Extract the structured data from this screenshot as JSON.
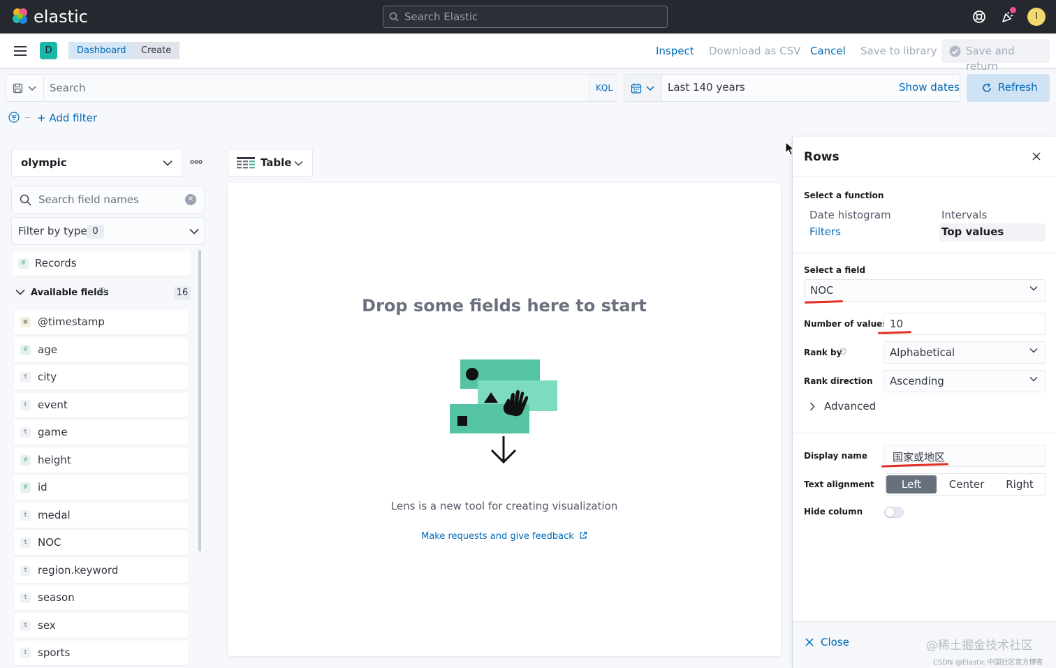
{
  "topbar": {
    "brand": "elastic",
    "search_placeholder": "Search Elastic",
    "avatar_initial": "I"
  },
  "header": {
    "space_initial": "D",
    "breadcrumbs": [
      "Dashboard",
      "Create"
    ],
    "actions": {
      "inspect": "Inspect",
      "download_csv": "Download as CSV",
      "cancel": "Cancel",
      "save_to_library": "Save to library",
      "save_and_return": "Save and return"
    }
  },
  "query": {
    "search_placeholder": "Search",
    "language": "KQL",
    "time_range": "Last 140 years",
    "show_dates": "Show dates",
    "refresh": "Refresh",
    "add_filter": "+ Add filter"
  },
  "datapanel": {
    "index_pattern": "olympic",
    "field_search_placeholder": "Search field names",
    "filter_by_type": "Filter by type",
    "filter_count": "0",
    "records_label": "Records",
    "available_label": "Available fields",
    "available_count": "16",
    "fields": [
      {
        "name": "@timestamp",
        "type": "date",
        "glyph": "▦"
      },
      {
        "name": "age",
        "type": "number",
        "glyph": "#"
      },
      {
        "name": "city",
        "type": "string",
        "glyph": "t"
      },
      {
        "name": "event",
        "type": "string",
        "glyph": "t"
      },
      {
        "name": "game",
        "type": "string",
        "glyph": "t"
      },
      {
        "name": "height",
        "type": "number",
        "glyph": "#"
      },
      {
        "name": "id",
        "type": "number",
        "glyph": "#"
      },
      {
        "name": "medal",
        "type": "string",
        "glyph": "t"
      },
      {
        "name": "NOC",
        "type": "string",
        "glyph": "t"
      },
      {
        "name": "region.keyword",
        "type": "string",
        "glyph": "t"
      },
      {
        "name": "season",
        "type": "string",
        "glyph": "t"
      },
      {
        "name": "sex",
        "type": "string",
        "glyph": "t"
      },
      {
        "name": "sports",
        "type": "string",
        "glyph": "t"
      }
    ]
  },
  "workspace": {
    "vis_type": "Table",
    "drop_title": "Drop some fields here to start",
    "lens_text": "Lens is a new tool for creating visualization",
    "feedback_link": "Make requests and give feedback"
  },
  "flyout": {
    "title": "Rows",
    "select_function_label": "Select a function",
    "functions": {
      "date_histogram": "Date histogram",
      "intervals": "Intervals",
      "filters": "Filters",
      "top_values": "Top values"
    },
    "select_field_label": "Select a field",
    "field_value": "NOC",
    "num_values_label": "Number of values",
    "num_values": "10",
    "rank_by_label": "Rank by",
    "rank_by": "Alphabetical",
    "rank_direction_label": "Rank direction",
    "rank_direction": "Ascending",
    "advanced": "Advanced",
    "display_name_label": "Display name",
    "display_name": "国家或地区",
    "text_alignment_label": "Text alignment",
    "alignments": [
      "Left",
      "Center",
      "Right"
    ],
    "hide_column_label": "Hide column",
    "hide_column": false,
    "close": "Close"
  },
  "watermark": {
    "line1": "@稀土掘金技术社区",
    "line2": "CSDN @Elastic 中国社区官方博客"
  },
  "colors": {
    "accent": "#006bb8",
    "header_bg": "#25282f",
    "space_badge": "#18b6a6",
    "annotation_red": "#e32d22"
  }
}
